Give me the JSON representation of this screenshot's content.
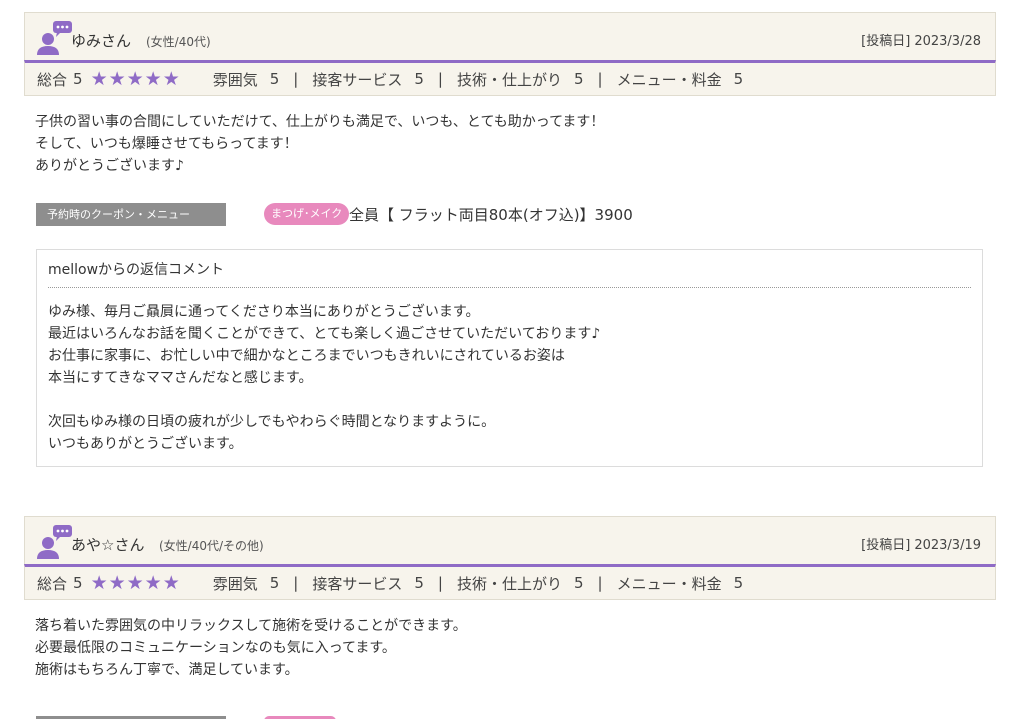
{
  "reviews": [
    {
      "name": "ゆみさん",
      "attributes": "(女性/40代)",
      "date_label": "[投稿日]",
      "date": "2023/3/28",
      "overall_label": "総合",
      "overall_score": "5",
      "stars": "★★★★★",
      "scores": [
        {
          "label": "雰囲気",
          "value": "5"
        },
        {
          "label": "接客サービス",
          "value": "5"
        },
        {
          "label": "技術・仕上がり",
          "value": "5"
        },
        {
          "label": "メニュー・料金",
          "value": "5"
        }
      ],
      "score_separator": "|",
      "body": "子供の習い事の合間にしていただけて、仕上がりも満足で、いつも、とても助かってます！\nそして、いつも爆睡させてもらってます！\nありがとうございます♪",
      "coupon_label": "予約時のクーポン・メニュー",
      "coupon_tag": "まつげ･メイク",
      "coupon_name": "全員【 フラット両目80本(オフ込)】3900",
      "reply_title": "mellowからの返信コメント",
      "reply_body": "ゆみ様、毎月ご贔屓に通ってくださり本当にありがとうございます。\n最近はいろんなお話を聞くことができて、とても楽しく過ごさせていただいております♪\nお仕事に家事に、お忙しい中で細かなところまでいつもきれいにされているお姿は\n本当にすてきなママさんだなと感じます。\n\n次回もゆみ様の日頃の疲れが少しでもやわらぐ時間となりますように。\nいつもありがとうございます。"
    },
    {
      "name": "あや☆さん",
      "attributes": "(女性/40代/その他)",
      "date_label": "[投稿日]",
      "date": "2023/3/19",
      "overall_label": "総合",
      "overall_score": "5",
      "stars": "★★★★★",
      "scores": [
        {
          "label": "雰囲気",
          "value": "5"
        },
        {
          "label": "接客サービス",
          "value": "5"
        },
        {
          "label": "技術・仕上がり",
          "value": "5"
        },
        {
          "label": "メニュー・料金",
          "value": "5"
        }
      ],
      "score_separator": "|",
      "body": "落ち着いた雰囲気の中リラックスして施術を受けることができます。\n必要最低限のコミュニケーションなのも気に入ってます。\n施術はもちろん丁寧で、満足しています。"
    }
  ],
  "colors": {
    "accent": "#8f6bc6",
    "header_bg": "#f7f4ec",
    "coupon_label_bg": "#8e8e8e",
    "coupon_tag_bg": "#e889bd"
  },
  "icons": {
    "avatar": "reviewer-avatar-icon"
  }
}
